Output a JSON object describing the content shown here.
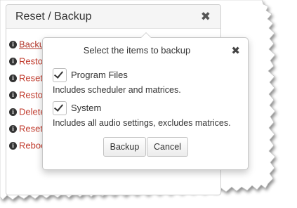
{
  "panel": {
    "title": "Reset / Backup",
    "close_icon": "close-icon",
    "menu": [
      {
        "label": "Backup",
        "icon": "info-icon",
        "active": true
      },
      {
        "label": "Restore",
        "icon": "info-icon"
      },
      {
        "label": "Reset",
        "icon": "info-icon"
      },
      {
        "label": "Restore",
        "icon": "info-icon"
      },
      {
        "label": "Delete",
        "icon": "info-icon"
      },
      {
        "label": "Reset",
        "icon": "info-icon"
      },
      {
        "label": "Reboot",
        "icon": "info-icon"
      }
    ]
  },
  "popover": {
    "title": "Select the items to backup",
    "close_icon": "close-icon",
    "options": [
      {
        "label": "Program Files",
        "checked": true,
        "description": "Includes scheduler and matrices."
      },
      {
        "label": "System",
        "checked": true,
        "description": "Includes all audio settings, excludes matrices."
      }
    ],
    "backup_label": "Backup",
    "cancel_label": "Cancel"
  },
  "colors": {
    "link": "#c0392b",
    "icon": "#333333",
    "border": "#cfcfcf"
  }
}
